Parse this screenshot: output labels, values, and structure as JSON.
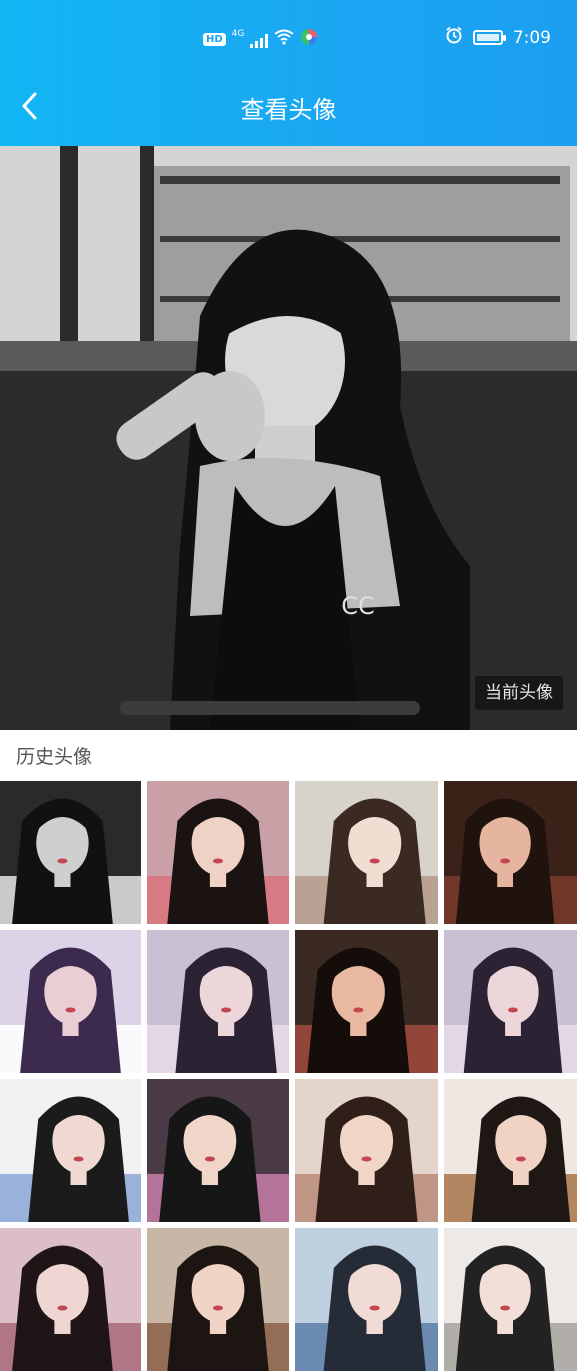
{
  "status_bar": {
    "hd": "HD",
    "network": "4G",
    "time": "7:09"
  },
  "nav": {
    "title": "查看头像"
  },
  "current_avatar": {
    "badge": "当前头像"
  },
  "history": {
    "label": "历史头像",
    "thumbnails": [
      {
        "bg": "#2a2a2a",
        "fg": "#e6e6e6",
        "skin": "#cfcfcf",
        "hair": "#111111"
      },
      {
        "bg": "#c9a0a6",
        "fg": "#d9737d",
        "skin": "#efd1c6",
        "hair": "#1b1212"
      },
      {
        "bg": "#d8d2cc",
        "fg": "#b49a8a",
        "skin": "#f2ddd2",
        "hair": "#3a2a22"
      },
      {
        "bg": "#3a2218",
        "fg": "#7a3a2a",
        "skin": "#e6b59f",
        "hair": "#20120c"
      },
      {
        "bg": "#dcd4e6",
        "fg": "#ffffff",
        "skin": "#e9cfd3",
        "hair": "#3d2b4f"
      },
      {
        "bg": "#c9c0d4",
        "fg": "#e7dbe9",
        "skin": "#edd6d9",
        "hair": "#2b2233"
      },
      {
        "bg": "#3a2a22",
        "fg": "#a14b3d",
        "skin": "#e8b9a0",
        "hair": "#140d0a"
      },
      {
        "bg": "#c9c0d4",
        "fg": "#e7dbe9",
        "skin": "#edd6d9",
        "hair": "#2b2233"
      },
      {
        "bg": "#f1f1f3",
        "fg": "#8aa6d6",
        "skin": "#efd9d0",
        "hair": "#1b1b1b"
      },
      {
        "bg": "#4a3a45",
        "fg": "#c77fa8",
        "skin": "#efd6c9",
        "hair": "#161616"
      },
      {
        "bg": "#e3d4cc",
        "fg": "#b98a78",
        "skin": "#f1d5c6",
        "hair": "#2f1f18"
      },
      {
        "bg": "#efe8e2",
        "fg": "#a7744a",
        "skin": "#f0d3c3",
        "hair": "#1e1714"
      },
      {
        "bg": "#dcbec6",
        "fg": "#a96a7a",
        "skin": "#f0d6d2",
        "hair": "#1f1416"
      },
      {
        "bg": "#c8b6a6",
        "fg": "#8a6048",
        "skin": "#f0d5c6",
        "hair": "#1d1512"
      },
      {
        "bg": "#bfd0e0",
        "fg": "#5c7ea6",
        "skin": "#f0dcd5",
        "hair": "#262b38"
      },
      {
        "bg": "#ece9e6",
        "fg": "#a7a29d",
        "skin": "#f2e0d8",
        "hair": "#222222"
      }
    ]
  }
}
